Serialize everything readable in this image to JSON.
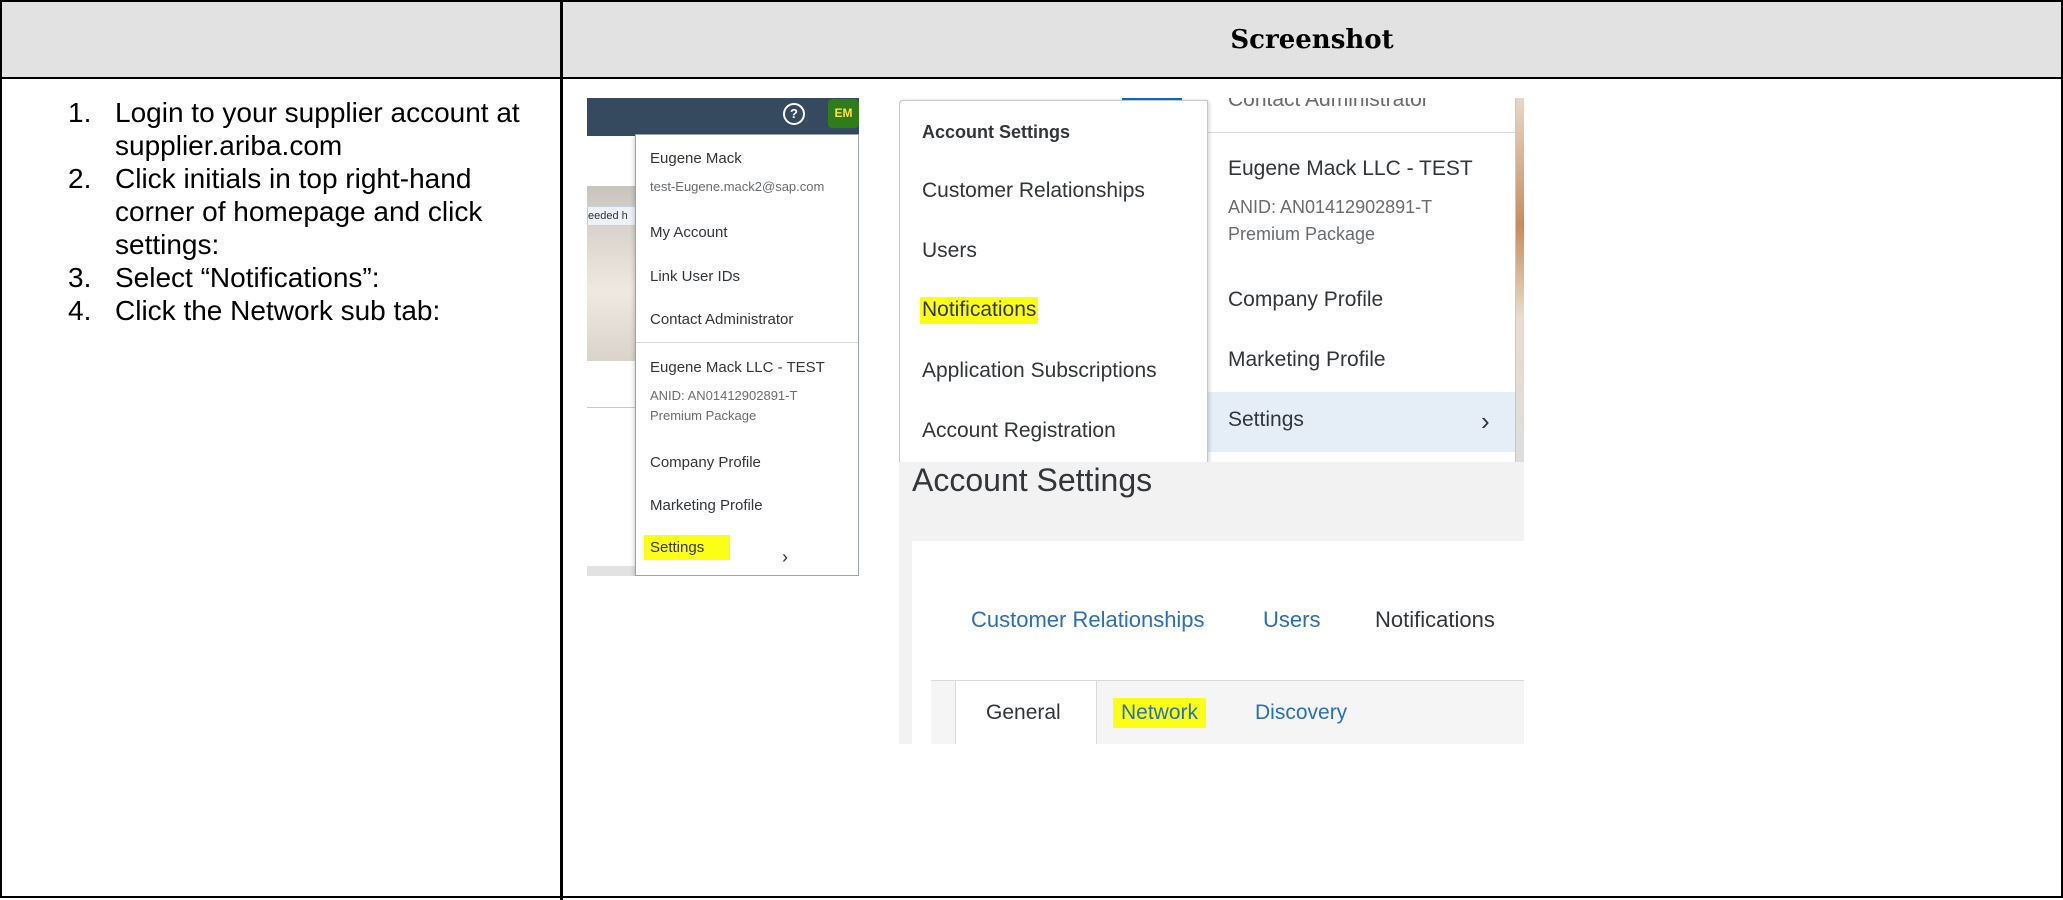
{
  "header": {
    "left": "",
    "right": "Screenshot"
  },
  "steps": [
    {
      "num": "1.",
      "text": "Login to your supplier account at supplier.ariba.com"
    },
    {
      "num": "2.",
      "text": "Click initials in top right-hand corner of homepage and click settings:"
    },
    {
      "num": "3.",
      "text": "Select “Notifications”:"
    },
    {
      "num": "4.",
      "text": "Click the Network sub tab:"
    }
  ],
  "panel1": {
    "help_glyph": "?",
    "avatar": "EM",
    "bg_snippet": "eeded h",
    "user_name": "Eugene Mack",
    "user_email": "test-Eugene.mack2@sap.com",
    "items_top": [
      "My Account",
      "Link User IDs",
      "Contact Administrator"
    ],
    "company": "Eugene Mack LLC - TEST",
    "anid": "ANID: AN01412902891-T",
    "package": "Premium Package",
    "items_bottom": [
      "Company Profile",
      "Marketing Profile"
    ],
    "settings": "Settings",
    "highlight_color": "#fbff16"
  },
  "panel2": {
    "header": "Account Settings",
    "items": [
      "Customer Relationships",
      "Users",
      "Notifications",
      "Application Subscriptions",
      "Account Registration"
    ],
    "right_top": "Contact Administrator",
    "company": "Eugene Mack LLC - TEST",
    "anid": "ANID: AN01412902891-T",
    "package": "Premium Package",
    "right_items": [
      "Company Profile",
      "Marketing Profile"
    ],
    "settings": "Settings"
  },
  "panel3": {
    "title": "Account Settings",
    "tabs": [
      "Customer Relationships",
      "Users",
      "Notifications"
    ],
    "subtabs": [
      "General",
      "Network",
      "Discovery"
    ]
  }
}
